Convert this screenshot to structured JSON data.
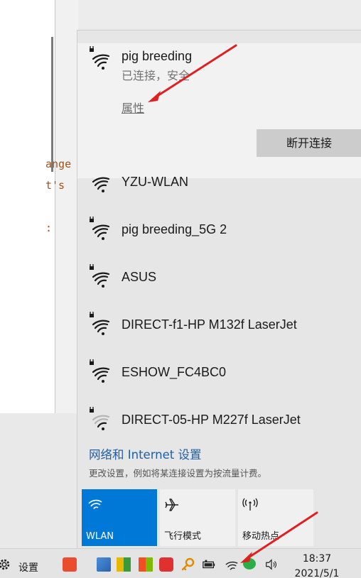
{
  "background": {
    "code_lines": [
      "ange",
      "t's",
      ":"
    ]
  },
  "connected": {
    "ssid": "pig breeding",
    "status": "已连接，安全",
    "properties_label": "属性",
    "disconnect_label": "断开连接"
  },
  "networks": [
    {
      "ssid": "YZU-WLAN",
      "secured": false,
      "strength": 4
    },
    {
      "ssid": "pig breeding_5G 2",
      "secured": true,
      "strength": 4
    },
    {
      "ssid": "ASUS",
      "secured": true,
      "strength": 4
    },
    {
      "ssid": "DIRECT-f1-HP M132f LaserJet",
      "secured": true,
      "strength": 4
    },
    {
      "ssid": "ESHOW_FC4BC0",
      "secured": true,
      "strength": 4
    },
    {
      "ssid": "DIRECT-05-HP M227f LaserJet",
      "secured": true,
      "strength": 2
    }
  ],
  "settings": {
    "link": "网络和 Internet 设置",
    "description": "更改设置，例如将某连接设置为按流量计费。"
  },
  "quick_actions": [
    {
      "label": "WLAN",
      "icon": "wifi-icon",
      "active": true
    },
    {
      "label": "飞行模式",
      "icon": "airplane-icon",
      "active": false
    },
    {
      "label": "移动热点",
      "icon": "hotspot-icon",
      "active": false
    }
  ],
  "taskbar": {
    "settings_label": "设置",
    "time": "18:37",
    "date": "2021/5/1"
  },
  "colors": {
    "accent": "#0078d7",
    "arrow": "#e02020",
    "link": "#1f5fa6"
  }
}
